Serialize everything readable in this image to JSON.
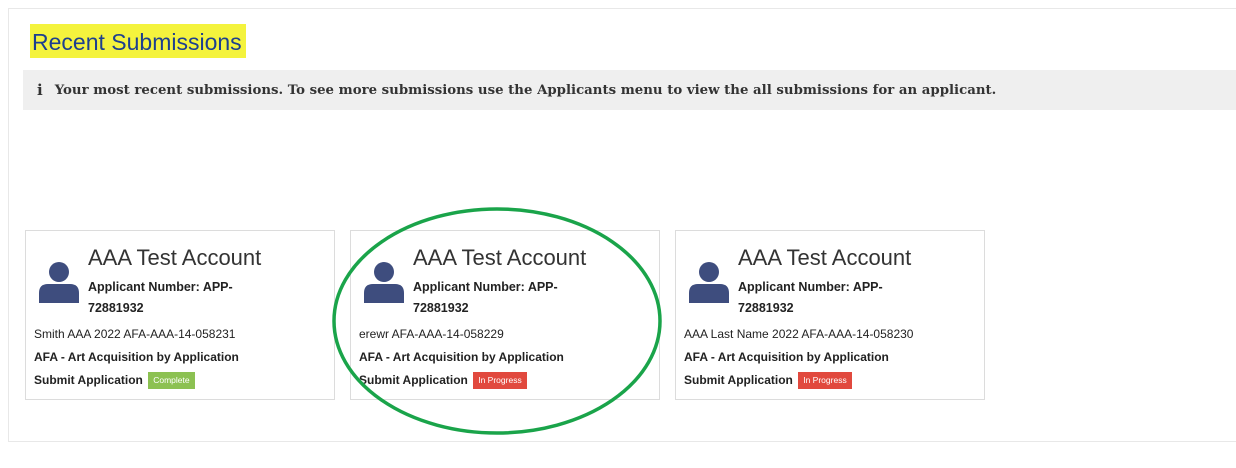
{
  "page": {
    "section_title": "Recent Submissions",
    "info_icon": "info-icon",
    "info_text": "Your most recent submissions. To see more submissions use the Applicants menu to view the all submissions for an applicant."
  },
  "colors": {
    "title_highlight": "#f4f33d",
    "title_text": "#1d3f8f",
    "avatar": "#3e4d7e",
    "status_complete": "#8cc152",
    "status_in_progress": "#e1493e",
    "annotation_circle": "#1aa44a"
  },
  "cards": [
    {
      "name": "AAA Test Account",
      "applicant_number": "Applicant Number: APP-72881932",
      "submission": "Smith AAA 2022 AFA-AAA-14-058231",
      "program": "AFA - Art Acquisition by Application",
      "stage": "Submit Application",
      "status": "Complete"
    },
    {
      "name": "AAA Test Account",
      "applicant_number": "Applicant Number: APP-72881932",
      "submission": "erewr AFA-AAA-14-058229",
      "program": "AFA - Art Acquisition by Application",
      "stage": "Submit Application",
      "status": "In Progress"
    },
    {
      "name": "AAA Test Account",
      "applicant_number": "Applicant Number: APP-72881932",
      "submission": "AAA Last Name 2022 AFA-AAA-14-058230",
      "program": "AFA - Art Acquisition by Application",
      "stage": "Submit Application",
      "status": "In Progress"
    }
  ]
}
